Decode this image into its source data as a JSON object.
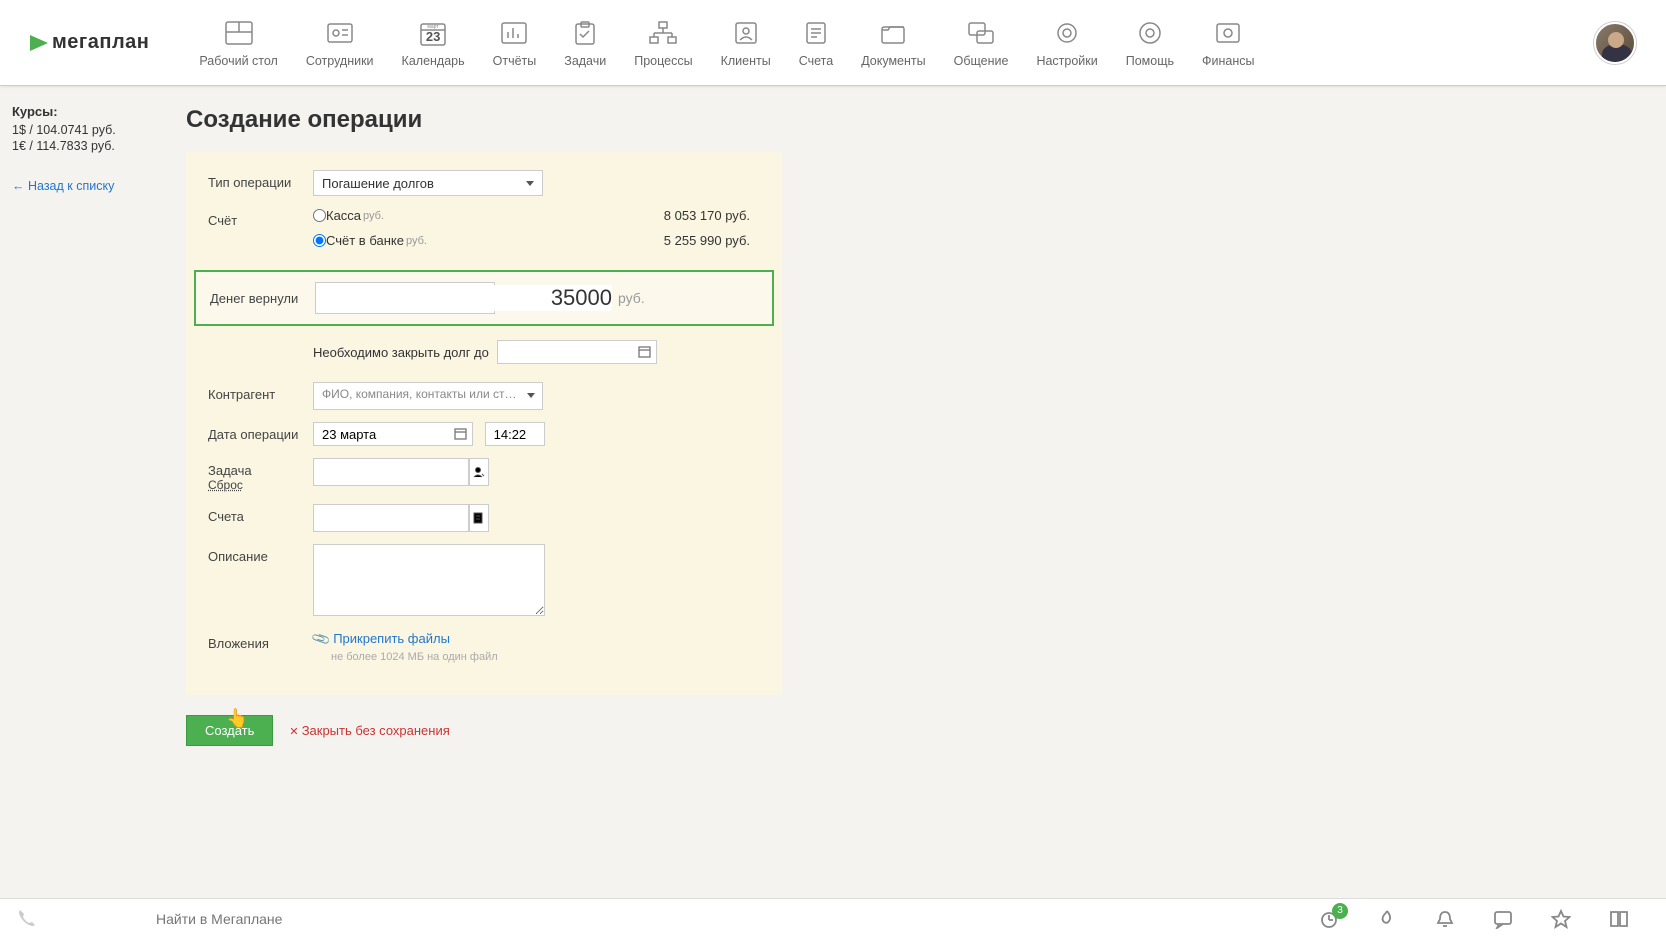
{
  "brand": "мегаплан",
  "nav": [
    {
      "label": "Рабочий стол"
    },
    {
      "label": "Сотрудники"
    },
    {
      "label": "Календарь",
      "day": "23",
      "month": "март"
    },
    {
      "label": "Отчёты"
    },
    {
      "label": "Задачи"
    },
    {
      "label": "Процессы"
    },
    {
      "label": "Клиенты"
    },
    {
      "label": "Счета"
    },
    {
      "label": "Документы"
    },
    {
      "label": "Общение"
    },
    {
      "label": "Настройки"
    },
    {
      "label": "Помощь"
    },
    {
      "label": "Финансы"
    }
  ],
  "sidebar": {
    "rates_title": "Курсы:",
    "usd": "1$ / 104.0741 руб.",
    "eur": "1€ / 114.7833 руб.",
    "back": "Назад к списку"
  },
  "page_title": "Создание операции",
  "form": {
    "type_label": "Тип операции",
    "type_value": "Погашение долгов",
    "account_label": "Счёт",
    "accounts": [
      {
        "name": "Касса",
        "currency": "руб.",
        "balance": "8 053 170 руб."
      },
      {
        "name": "Счёт в банке",
        "currency": "руб.",
        "balance": "5 255 990 руб."
      }
    ],
    "selected_account": 1,
    "amount_label": "Денег вернули",
    "amount_value": "35000",
    "amount_currency": "руб.",
    "debt_deadline_label": "Необходимо закрыть долг до",
    "debt_deadline_value": "",
    "counterparty_label": "Контрагент",
    "counterparty_placeholder": "ФИО, компания, контакты или стрелка вниз для ручного поиска",
    "date_label": "Дата операции",
    "date_value": "23 марта",
    "time_value": "14:22",
    "task_label": "Задача",
    "reset_label": "Сброс",
    "invoices_label": "Счета",
    "description_label": "Описание",
    "attachments_label": "Вложения",
    "attach_link": "Прикрепить файлы",
    "attach_hint": "не более 1024 МБ на один файл",
    "create_btn": "Создать",
    "cancel_btn": "Закрыть без сохранения"
  },
  "bottom": {
    "search_placeholder": "Найти в Мегаплане",
    "badge_count": "3"
  }
}
